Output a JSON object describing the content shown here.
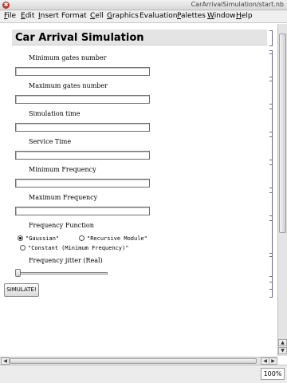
{
  "window": {
    "title": "CarArrivalSimulation/start.nb"
  },
  "menu": [
    {
      "u": "F",
      "rest": "ile"
    },
    {
      "u": "E",
      "rest": "dit"
    },
    {
      "u": "I",
      "rest": "nsert"
    },
    {
      "u": "",
      "rest": "Format"
    },
    {
      "u": "C",
      "rest": "ell"
    },
    {
      "u": "G",
      "rest": "raphics"
    },
    {
      "u": "",
      "rest": "Evaluation"
    },
    {
      "u": "P",
      "rest": "alettes"
    },
    {
      "u": "W",
      "rest": "indow"
    },
    {
      "u": "H",
      "rest": "elp"
    }
  ],
  "notebook": {
    "title": "Car Arrival Simulation",
    "fields": [
      {
        "label": "Minimum gates number",
        "value": ""
      },
      {
        "label": "Maximum gates number",
        "value": ""
      },
      {
        "label": "Simulation time",
        "value": ""
      },
      {
        "label": "Service Time",
        "value": ""
      },
      {
        "label": "Minimum Frequency",
        "value": ""
      },
      {
        "label": "Maximum Frequency",
        "value": ""
      }
    ],
    "frequency_function": {
      "label": "Frequency Function",
      "options": [
        "\"Gaussian\"",
        "\"Recursive Module\"",
        "\"Constant (Minimum Frequency)\""
      ],
      "selected": "\"Gaussian\""
    },
    "jitter": {
      "label": "Frequency jitter (Real)",
      "value": 0
    },
    "simulate_label": "SIMULATE!"
  },
  "status": {
    "zoom": "100%"
  },
  "icons": {
    "app": "mathematica-icon"
  }
}
